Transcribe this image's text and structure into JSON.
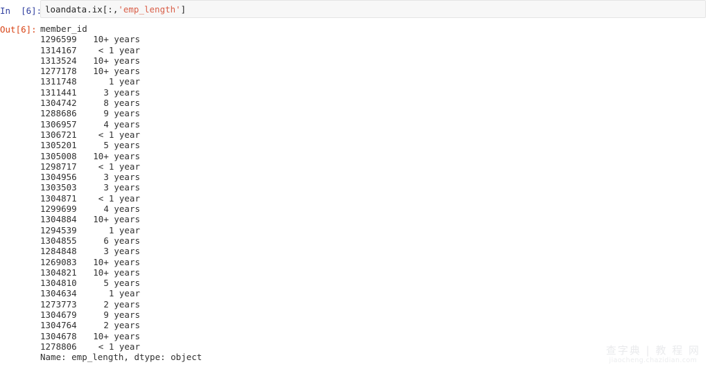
{
  "cell": {
    "input_prompt": "In  [6]:",
    "output_prompt": "Out[6]:",
    "code_prefix": "loandata.ix[:,",
    "code_string": "'emp_length'",
    "code_suffix": "]"
  },
  "output": {
    "header": "member_id",
    "footer": "Name: emp_length, dtype: object",
    "rows": [
      {
        "index": "1296599",
        "value": "10+ years"
      },
      {
        "index": "1314167",
        "value": "< 1 year"
      },
      {
        "index": "1313524",
        "value": "10+ years"
      },
      {
        "index": "1277178",
        "value": "10+ years"
      },
      {
        "index": "1311748",
        "value": "1 year"
      },
      {
        "index": "1311441",
        "value": "3 years"
      },
      {
        "index": "1304742",
        "value": "8 years"
      },
      {
        "index": "1288686",
        "value": "9 years"
      },
      {
        "index": "1306957",
        "value": "4 years"
      },
      {
        "index": "1306721",
        "value": "< 1 year"
      },
      {
        "index": "1305201",
        "value": "5 years"
      },
      {
        "index": "1305008",
        "value": "10+ years"
      },
      {
        "index": "1298717",
        "value": "< 1 year"
      },
      {
        "index": "1304956",
        "value": "3 years"
      },
      {
        "index": "1303503",
        "value": "3 years"
      },
      {
        "index": "1304871",
        "value": "< 1 year"
      },
      {
        "index": "1299699",
        "value": "4 years"
      },
      {
        "index": "1304884",
        "value": "10+ years"
      },
      {
        "index": "1294539",
        "value": "1 year"
      },
      {
        "index": "1304855",
        "value": "6 years"
      },
      {
        "index": "1284848",
        "value": "3 years"
      },
      {
        "index": "1269083",
        "value": "10+ years"
      },
      {
        "index": "1304821",
        "value": "10+ years"
      },
      {
        "index": "1304810",
        "value": "5 years"
      },
      {
        "index": "1304634",
        "value": "1 year"
      },
      {
        "index": "1273773",
        "value": "2 years"
      },
      {
        "index": "1304679",
        "value": "9 years"
      },
      {
        "index": "1304764",
        "value": "2 years"
      },
      {
        "index": "1304678",
        "value": "10+ years"
      },
      {
        "index": "1278806",
        "value": "< 1 year"
      }
    ]
  },
  "watermark": {
    "main": "查字典 | 教 程 网",
    "sub": "jiaocheng.chazidian.com"
  },
  "colors": {
    "in_prompt": "#303f9f",
    "out_prompt": "#d84315",
    "string_token": "#d9604a",
    "code_text": "#262626",
    "cell_background": "#f7f7f7"
  }
}
